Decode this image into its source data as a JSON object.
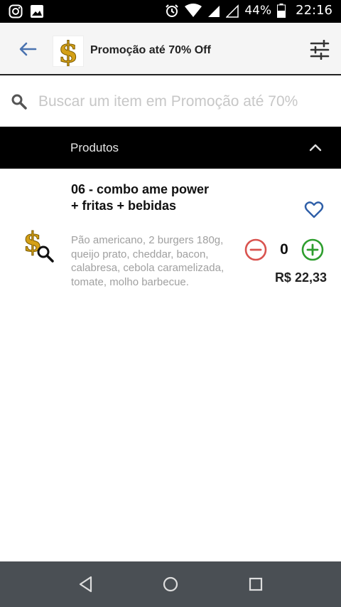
{
  "status_bar": {
    "battery": "44%",
    "time": "22:16",
    "icons": [
      "instagram-icon",
      "image-icon",
      "alarm-icon",
      "wifi-icon",
      "signal-icon",
      "signal-empty-icon",
      "battery-icon"
    ]
  },
  "app_bar": {
    "title": "Promoção até 70% Off",
    "icons": [
      "back-arrow-icon",
      "dollar-logo",
      "filter-sliders-icon"
    ]
  },
  "search": {
    "placeholder": "Buscar um item em Promoção até 70%",
    "value": ""
  },
  "section": {
    "label": "Produtos",
    "icon": "chevron-up-icon"
  },
  "product": {
    "name": "06 - combo ame power + fritas + bebidas",
    "description": "Pão americano, 2 burgers 180g, queijo prato, cheddar, bacon, calabresa, cebola caramelizada, tomate, molho barbecue.",
    "quantity": "0",
    "price": "R$ 22,33",
    "icons": [
      "dollar-search-icon",
      "heart-icon",
      "minus-circle-icon",
      "plus-circle-icon"
    ]
  },
  "colors": {
    "accent_blue": "#2f5fa8",
    "minus_red": "#d9534f",
    "plus_green": "#2e9e2e",
    "header_bg": "#000000",
    "nav_bg": "#4a4f54"
  }
}
